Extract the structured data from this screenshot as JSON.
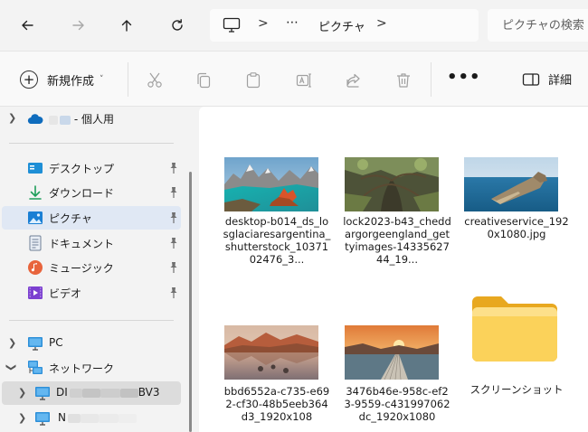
{
  "address_bar": {
    "location_icon": "pc-monitor-icon",
    "overflow": "⋯",
    "breadcrumb": "ピクチャ",
    "separator": ">"
  },
  "search": {
    "placeholder": "ピクチャの検索"
  },
  "toolbar": {
    "new_label": "新規作成",
    "new_caret": "˅",
    "more": "•••",
    "details_label": "詳細",
    "icons": [
      "cut-icon",
      "copy-icon",
      "paste-icon",
      "rename-icon",
      "share-icon",
      "delete-icon"
    ]
  },
  "sidebar": {
    "onedrive": {
      "label_suffix": "- 個人用",
      "icon": "cloud-icon"
    },
    "quick_access": [
      {
        "label": "デスクトップ",
        "icon": "desktop-icon"
      },
      {
        "label": "ダウンロード",
        "icon": "download-icon"
      },
      {
        "label": "ピクチャ",
        "icon": "pictures-icon",
        "selected": true
      },
      {
        "label": "ドキュメント",
        "icon": "documents-icon"
      },
      {
        "label": "ミュージック",
        "icon": "music-icon"
      },
      {
        "label": "ビデオ",
        "icon": "videos-icon"
      }
    ],
    "pc": {
      "label": "PC",
      "icon": "pc-icon"
    },
    "network": {
      "label": "ネットワーク",
      "icon": "network-icon"
    },
    "network_children": [
      {
        "label_prefix": "DI",
        "label_suffix": "BV3",
        "icon": "computer-icon"
      },
      {
        "label_prefix": "N",
        "label_suffix": "",
        "icon": "computer-icon"
      }
    ]
  },
  "files": [
    {
      "name": "desktop-b014_ds_losglaciaresargentina_shutterstock_1037102476_3...",
      "kind": "image"
    },
    {
      "name": "lock2023-b43_cheddargorgeengland_gettyimages-1433562744_19...",
      "kind": "image"
    },
    {
      "name": "creativeservice_1920x1080.jpg",
      "kind": "image"
    },
    {
      "name": "bbd6552a-c735-e692-cf30-48b5eeb364d3_1920x108",
      "kind": "image"
    },
    {
      "name": "3476b46e-958c-ef23-9559-c431997062dc_1920x1080",
      "kind": "image"
    },
    {
      "name": "スクリーンショット",
      "kind": "folder"
    }
  ],
  "colors": {
    "accent": "#0067c0",
    "folder": "#f8c842",
    "selected_bg": "#e0e8f4"
  }
}
